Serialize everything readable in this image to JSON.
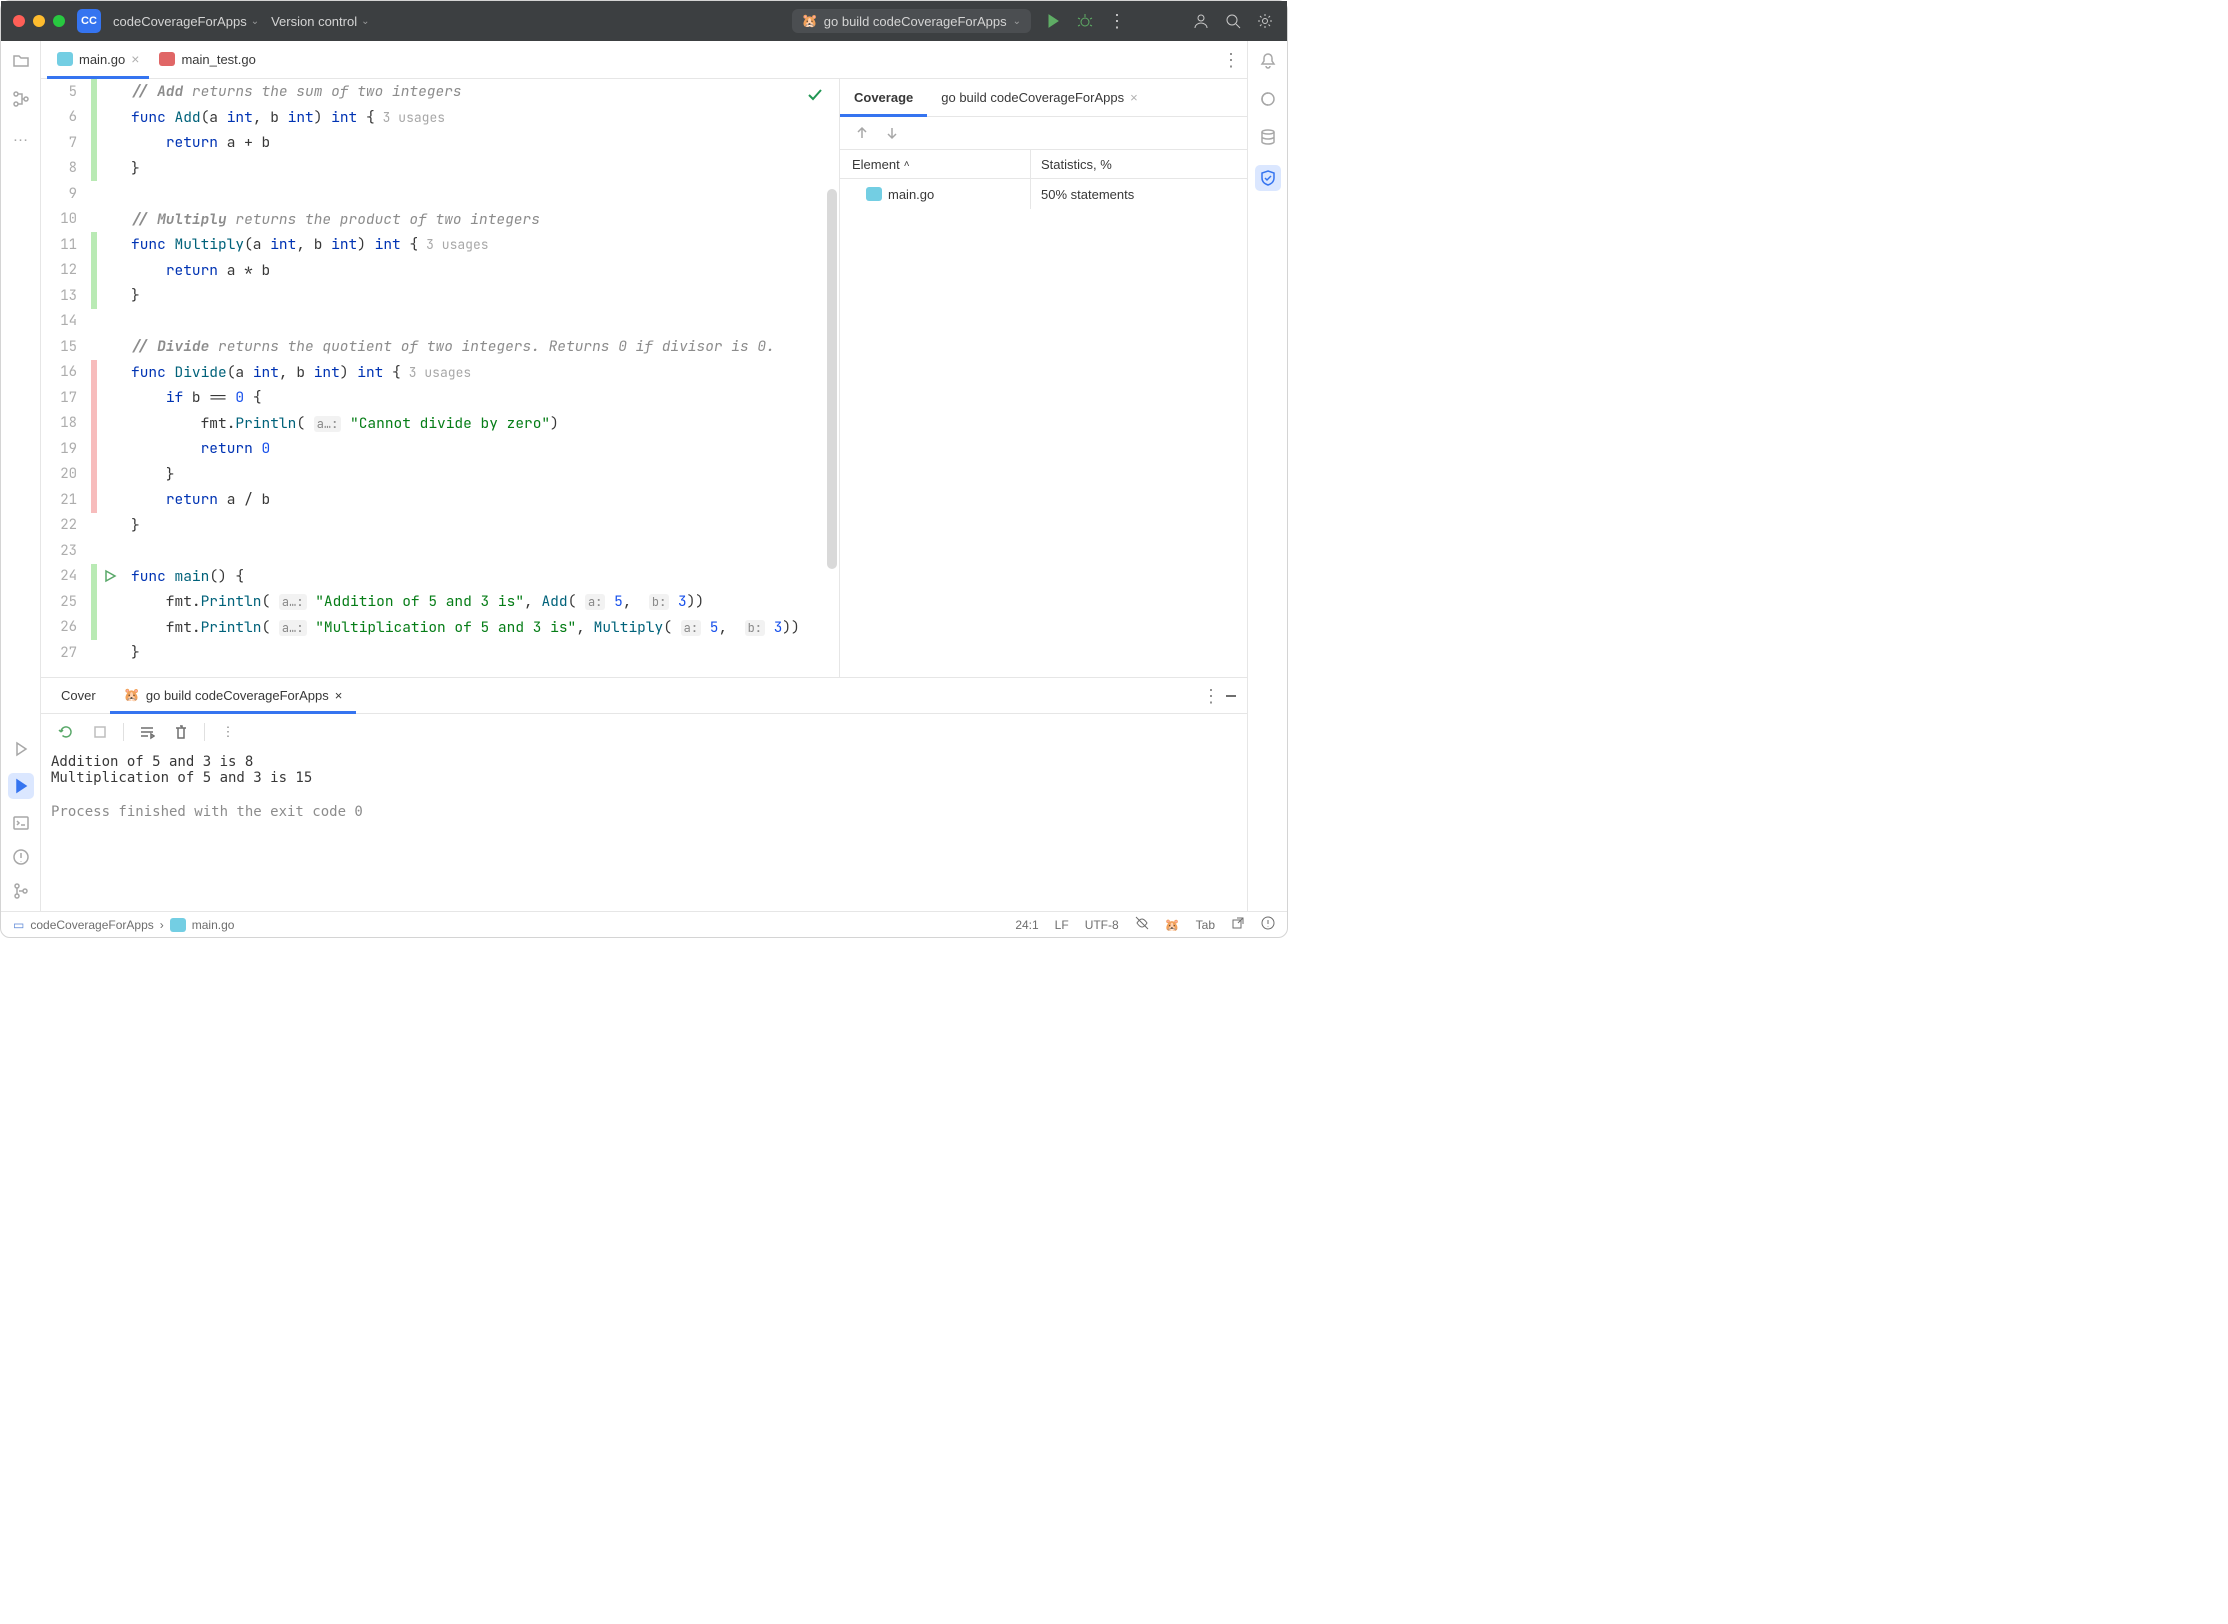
{
  "titlebar": {
    "project": "codeCoverageForApps",
    "vcs": "Version control",
    "run_config": "go build codeCoverageForApps"
  },
  "tabs": [
    {
      "name": "main.go",
      "active": true,
      "type": "go"
    },
    {
      "name": "main_test.go",
      "active": false,
      "type": "go_test"
    }
  ],
  "coverage": {
    "title": "Coverage",
    "config": "go build codeCoverageForApps",
    "columns": {
      "element": "Element",
      "stats": "Statistics, %"
    },
    "rows": [
      {
        "name": "main.go",
        "stats": "50% statements"
      }
    ]
  },
  "editor": {
    "lines": [
      {
        "n": 5,
        "cov": "g",
        "segments": [
          {
            "cls": "cmh",
            "t": "// Add "
          },
          {
            "cls": "cm",
            "t": "returns the sum of two integers"
          }
        ]
      },
      {
        "n": 6,
        "cov": "g",
        "segments": [
          {
            "cls": "kw",
            "t": "func "
          },
          {
            "cls": "fn",
            "t": "Add"
          },
          {
            "t": "(a "
          },
          {
            "cls": "ty",
            "t": "int"
          },
          {
            "t": ", b "
          },
          {
            "cls": "ty",
            "t": "int"
          },
          {
            "t": ") "
          },
          {
            "cls": "ty",
            "t": "int"
          },
          {
            "t": " {"
          }
        ],
        "usages": "3 usages"
      },
      {
        "n": 7,
        "cov": "g",
        "segments": [
          {
            "t": "    "
          },
          {
            "cls": "kw",
            "t": "return"
          },
          {
            "t": " a + b"
          }
        ]
      },
      {
        "n": 8,
        "cov": "g",
        "segments": [
          {
            "t": "}"
          }
        ]
      },
      {
        "n": 9,
        "segments": [
          {
            "t": ""
          }
        ]
      },
      {
        "n": 10,
        "segments": [
          {
            "cls": "cmh",
            "t": "// Multiply "
          },
          {
            "cls": "cm",
            "t": "returns the product of two integers"
          }
        ]
      },
      {
        "n": 11,
        "cov": "g",
        "segments": [
          {
            "cls": "kw",
            "t": "func "
          },
          {
            "cls": "fn",
            "t": "Multiply"
          },
          {
            "t": "(a "
          },
          {
            "cls": "ty",
            "t": "int"
          },
          {
            "t": ", b "
          },
          {
            "cls": "ty",
            "t": "int"
          },
          {
            "t": ") "
          },
          {
            "cls": "ty",
            "t": "int"
          },
          {
            "t": " {"
          }
        ],
        "usages": "3 usages"
      },
      {
        "n": 12,
        "cov": "g",
        "segments": [
          {
            "t": "    "
          },
          {
            "cls": "kw",
            "t": "return"
          },
          {
            "t": " a * b"
          }
        ]
      },
      {
        "n": 13,
        "cov": "g",
        "segments": [
          {
            "t": "}"
          }
        ]
      },
      {
        "n": 14,
        "segments": [
          {
            "t": ""
          }
        ]
      },
      {
        "n": 15,
        "segments": [
          {
            "cls": "cmh",
            "t": "// Divide "
          },
          {
            "cls": "cm",
            "t": "returns the quotient of two integers. Returns 0 if divisor is 0."
          }
        ]
      },
      {
        "n": 16,
        "cov": "r",
        "segments": [
          {
            "cls": "kw",
            "t": "func "
          },
          {
            "cls": "fn",
            "t": "Divide"
          },
          {
            "t": "(a "
          },
          {
            "cls": "ty",
            "t": "int"
          },
          {
            "t": ", b "
          },
          {
            "cls": "ty",
            "t": "int"
          },
          {
            "t": ") "
          },
          {
            "cls": "ty",
            "t": "int"
          },
          {
            "t": " {"
          }
        ],
        "usages": "3 usages"
      },
      {
        "n": 17,
        "cov": "r",
        "segments": [
          {
            "t": "    "
          },
          {
            "cls": "kw",
            "t": "if"
          },
          {
            "t": " b == "
          },
          {
            "cls": "num",
            "t": "0"
          },
          {
            "t": " {"
          }
        ]
      },
      {
        "n": 18,
        "cov": "r",
        "segments": [
          {
            "t": "        fmt."
          },
          {
            "cls": "fn",
            "t": "Println"
          },
          {
            "t": "( "
          },
          {
            "cls": "hint",
            "t": "a…:"
          },
          {
            "t": " "
          },
          {
            "cls": "str",
            "t": "\"Cannot divide by zero\""
          },
          {
            "t": ")"
          }
        ]
      },
      {
        "n": 19,
        "cov": "r",
        "segments": [
          {
            "t": "        "
          },
          {
            "cls": "kw",
            "t": "return"
          },
          {
            "t": " "
          },
          {
            "cls": "num",
            "t": "0"
          }
        ]
      },
      {
        "n": 20,
        "cov": "r",
        "segments": [
          {
            "t": "    }"
          }
        ]
      },
      {
        "n": 21,
        "cov": "r",
        "segments": [
          {
            "t": "    "
          },
          {
            "cls": "kw",
            "t": "return"
          },
          {
            "t": " a / b"
          }
        ]
      },
      {
        "n": 22,
        "segments": [
          {
            "t": "}"
          }
        ]
      },
      {
        "n": 23,
        "segments": [
          {
            "t": ""
          }
        ]
      },
      {
        "n": 24,
        "cov": "g",
        "gutter": "run",
        "segments": [
          {
            "cls": "kw",
            "t": "func "
          },
          {
            "cls": "fn",
            "t": "main"
          },
          {
            "t": "() {"
          }
        ]
      },
      {
        "n": 25,
        "cov": "g",
        "segments": [
          {
            "t": "    fmt."
          },
          {
            "cls": "fn",
            "t": "Println"
          },
          {
            "t": "( "
          },
          {
            "cls": "hint",
            "t": "a…:"
          },
          {
            "t": " "
          },
          {
            "cls": "str",
            "t": "\"Addition of 5 and 3 is\""
          },
          {
            "t": ", "
          },
          {
            "cls": "fn",
            "t": "Add"
          },
          {
            "t": "( "
          },
          {
            "cls": "hint",
            "t": "a:"
          },
          {
            "t": " "
          },
          {
            "cls": "num",
            "t": "5"
          },
          {
            "t": ",  "
          },
          {
            "cls": "hint",
            "t": "b:"
          },
          {
            "t": " "
          },
          {
            "cls": "num",
            "t": "3"
          },
          {
            "t": "))"
          }
        ]
      },
      {
        "n": 26,
        "cov": "g",
        "segments": [
          {
            "t": "    fmt."
          },
          {
            "cls": "fn",
            "t": "Println"
          },
          {
            "t": "( "
          },
          {
            "cls": "hint",
            "t": "a…:"
          },
          {
            "t": " "
          },
          {
            "cls": "str",
            "t": "\"Multiplication of 5 and 3 is\""
          },
          {
            "t": ", "
          },
          {
            "cls": "fn",
            "t": "Multiply"
          },
          {
            "t": "( "
          },
          {
            "cls": "hint",
            "t": "a:"
          },
          {
            "t": " "
          },
          {
            "cls": "num",
            "t": "5"
          },
          {
            "t": ",  "
          },
          {
            "cls": "hint",
            "t": "b:"
          },
          {
            "t": " "
          },
          {
            "cls": "num",
            "t": "3"
          },
          {
            "t": "))"
          }
        ]
      },
      {
        "n": 27,
        "segments": [
          {
            "t": "}"
          }
        ]
      }
    ]
  },
  "run": {
    "tab_cover": "Cover",
    "tab_config": "go build codeCoverageForApps",
    "output": [
      "Addition of 5 and 3 is 8",
      "Multiplication of 5 and 3 is 15"
    ],
    "exit": "Process finished with the exit code 0"
  },
  "statusbar": {
    "crumb_project": "codeCoverageForApps",
    "crumb_file": "main.go",
    "caret": "24:1",
    "eol": "LF",
    "encoding": "UTF-8",
    "indent": "Tab"
  }
}
